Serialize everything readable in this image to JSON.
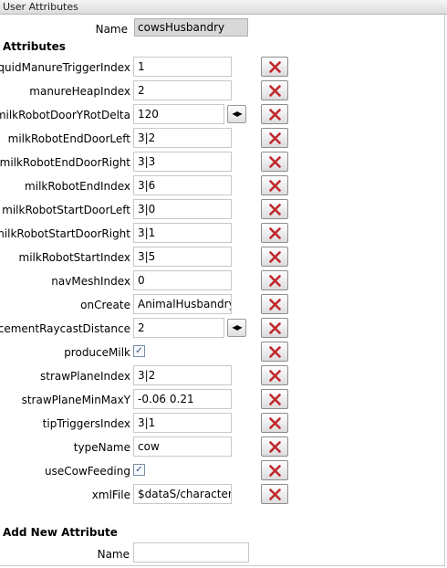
{
  "window": {
    "title": "User Attributes"
  },
  "node": {
    "name_label": "Name",
    "name_value": "cowsHusbandry"
  },
  "attributes": {
    "header": "Attributes",
    "rows": [
      {
        "label": "liquidManureTriggerIndex",
        "kind": "text",
        "value": "1"
      },
      {
        "label": "manureHeapIndex",
        "kind": "text",
        "value": "2"
      },
      {
        "label": "milkRobotDoorYRotDelta",
        "kind": "number",
        "value": "120"
      },
      {
        "label": "milkRobotEndDoorLeft",
        "kind": "text",
        "value": "3|2"
      },
      {
        "label": "milkRobotEndDoorRight",
        "kind": "text",
        "value": "3|3"
      },
      {
        "label": "milkRobotEndIndex",
        "kind": "text",
        "value": "3|6"
      },
      {
        "label": "milkRobotStartDoorLeft",
        "kind": "text",
        "value": "3|0"
      },
      {
        "label": "milkRobotStartDoorRight",
        "kind": "text",
        "value": "3|1"
      },
      {
        "label": "milkRobotStartIndex",
        "kind": "text",
        "value": "3|5"
      },
      {
        "label": "navMeshIndex",
        "kind": "text",
        "value": "0"
      },
      {
        "label": "onCreate",
        "kind": "text",
        "value": "AnimalHusbandry.c"
      },
      {
        "label": "placementRaycastDistance",
        "kind": "number",
        "value": "2"
      },
      {
        "label": "produceMilk",
        "kind": "checkbox",
        "checked": true
      },
      {
        "label": "strawPlaneIndex",
        "kind": "text",
        "value": "3|2"
      },
      {
        "label": "strawPlaneMinMaxY",
        "kind": "text",
        "value": "-0.06 0.21"
      },
      {
        "label": "tipTriggersIndex",
        "kind": "text",
        "value": "3|1"
      },
      {
        "label": "typeName",
        "kind": "text",
        "value": "cow"
      },
      {
        "label": "useCowFeeding",
        "kind": "checkbox",
        "checked": true
      },
      {
        "label": "xmlFile",
        "kind": "text",
        "value": "$dataS/character/c"
      }
    ]
  },
  "add_new": {
    "header": "Add New Attribute",
    "name_label": "Name",
    "name_value": ""
  },
  "colors": {
    "delete_icon": "#c0282c",
    "readonly_bg": "#d8d8d8"
  },
  "icons": {
    "delete": "red-x-icon",
    "stepper": "left-right-arrows-icon",
    "checkbox": "checkmark-icon"
  }
}
